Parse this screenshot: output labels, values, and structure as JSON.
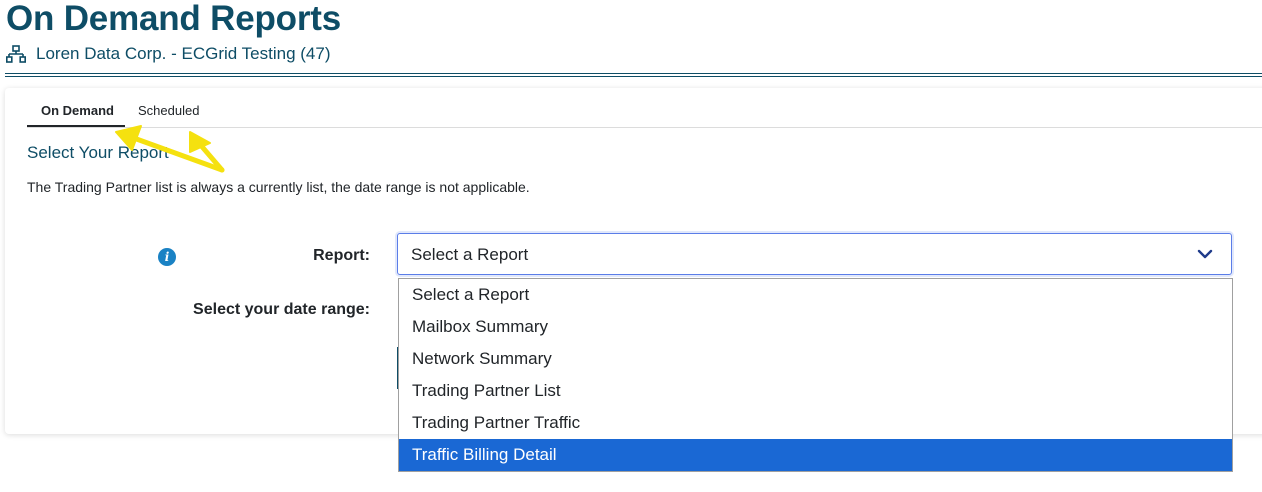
{
  "page": {
    "title": "On Demand Reports",
    "subtitle": "Loren Data Corp. - ECGrid Testing (47)",
    "subtitle_icon": "network-icon"
  },
  "tabs": [
    {
      "label": "On Demand",
      "active": true
    },
    {
      "label": "Scheduled",
      "active": false
    }
  ],
  "section": {
    "title": "Select Your Report",
    "note": "The Trading Partner list is always a currently list, the date range is not applicable."
  },
  "form": {
    "info_icon": "info-icon",
    "report_label": "Report:",
    "date_range_label": "Select your date range:",
    "report_select": {
      "value": "Select a Report",
      "options": [
        "Select a Report",
        "Mailbox Summary",
        "Network Summary",
        "Trading Partner List",
        "Trading Partner Traffic",
        "Traffic Billing Detail"
      ],
      "highlighted": "Traffic Billing Detail"
    }
  },
  "colors": {
    "brand": "#0e4d66",
    "highlight": "#1a68d4",
    "annotation": "#f5e10f"
  }
}
